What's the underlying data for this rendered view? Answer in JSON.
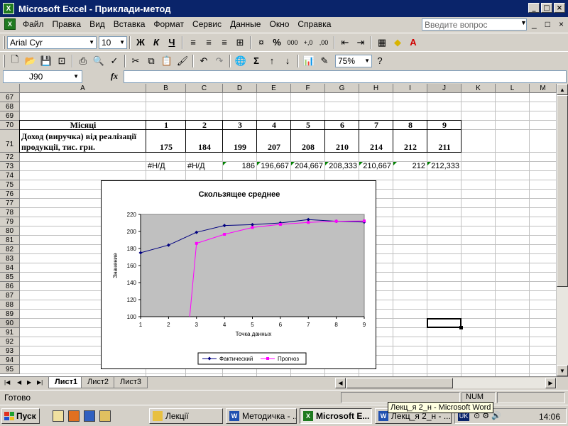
{
  "window": {
    "title": "Microsoft Excel - Приклади-метод",
    "app_icon": "excel-icon",
    "minimize": "_",
    "maximize": "□",
    "close": "×"
  },
  "menu": {
    "items": [
      "Файл",
      "Правка",
      "Вид",
      "Вставка",
      "Формат",
      "Сервис",
      "Данные",
      "Окно",
      "Справка"
    ],
    "help_placeholder": "Введите вопрос",
    "doc_controls": [
      "_",
      "□",
      "×"
    ]
  },
  "toolbar1": {
    "font": "Arial Cyr",
    "size": "10",
    "bold": "Ж",
    "italic": "К",
    "underline": "Ч",
    "percent": "%",
    "thousands": "000",
    "dec_inc": "+,0",
    "dec_dec": ",00"
  },
  "toolbar2": {
    "sum": "Σ",
    "zoom": "75%"
  },
  "formula_bar": {
    "name_box": "J90",
    "fx": "fx",
    "value": ""
  },
  "grid": {
    "columns": [
      "A",
      "B",
      "C",
      "D",
      "E",
      "F",
      "G",
      "H",
      "I",
      "J",
      "K",
      "L",
      "M"
    ],
    "rows": [
      "67",
      "68",
      "69",
      "70",
      "71",
      "72",
      "73",
      "74",
      "75",
      "76",
      "77",
      "78",
      "79",
      "80",
      "81",
      "82",
      "83",
      "84",
      "85",
      "86",
      "87",
      "88",
      "89",
      "90",
      "91",
      "92",
      "93",
      "94",
      "95"
    ],
    "row70_label": "Місяці",
    "row70_values": [
      "1",
      "2",
      "3",
      "4",
      "5",
      "6",
      "7",
      "8",
      "9"
    ],
    "row71_label_line1": "Доход  (виручка)  від реалізації",
    "row71_label_line2": "продукції,  тис. грн.",
    "row71_values": [
      "175",
      "184",
      "199",
      "207",
      "208",
      "210",
      "214",
      "212",
      "211"
    ],
    "row73_values": [
      "#Н/Д",
      "#Н/Д",
      "186",
      "196,667",
      "204,667",
      "208,333",
      "210,667",
      "212",
      "212,333"
    ]
  },
  "chart": {
    "title": "Скользящее среднее",
    "xlabel": "Точка данных",
    "ylabel": "Значение",
    "y_ticks": [
      "100",
      "120",
      "140",
      "160",
      "180",
      "200",
      "220"
    ],
    "x_ticks": [
      "1",
      "2",
      "3",
      "4",
      "5",
      "6",
      "7",
      "8",
      "9"
    ],
    "legend": [
      "Фактический",
      "Прогноз"
    ]
  },
  "chart_data": {
    "type": "line",
    "title": "Скользящее среднее",
    "xlabel": "Точка данных",
    "ylabel": "Значение",
    "x": [
      1,
      2,
      3,
      4,
      5,
      6,
      7,
      8,
      9
    ],
    "ylim": [
      100,
      220
    ],
    "xlim": [
      1,
      9
    ],
    "grid": false,
    "legend_position": "bottom",
    "series": [
      {
        "name": "Фактический",
        "color": "#000080",
        "values": [
          175,
          184,
          199,
          207,
          208,
          210,
          214,
          212,
          211
        ]
      },
      {
        "name": "Прогноз",
        "color": "#ff00ff",
        "values": [
          null,
          null,
          186,
          196.667,
          204.667,
          208.333,
          210.667,
          212,
          212.333
        ]
      }
    ]
  },
  "sheets": {
    "tabs": [
      "Лист1",
      "Лист2",
      "Лист3"
    ],
    "active": "Лист1"
  },
  "status": {
    "text": "Готово",
    "num": "NUM"
  },
  "taskbar": {
    "start": "Пуск",
    "buttons": [
      "Лекції",
      "Методичка - ...",
      "Microsoft E...",
      "Лекц_я 2_н - ..."
    ],
    "lang": "UK",
    "clock": "14:06",
    "tooltip": "Лекц_я 2_н - Microsoft Word"
  }
}
